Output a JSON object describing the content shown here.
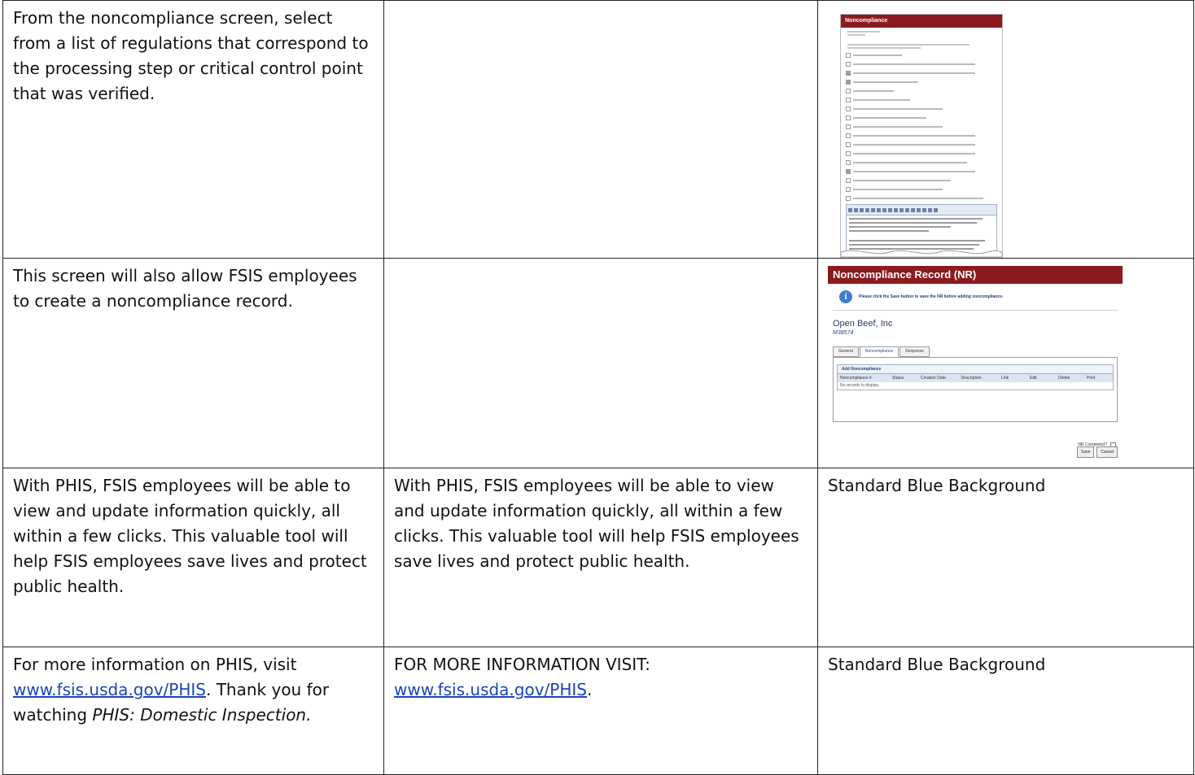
{
  "rows": [
    {
      "col1": "From the noncompliance screen, select from a list of regulations that correspond to the processing step or critical control point that was verified.",
      "col2": "",
      "col3_screenshot": {
        "header": "Noncompliance"
      }
    },
    {
      "col1": "This screen will also allow FSIS employees to create a noncompliance record.",
      "col2": "",
      "col3_screenshot": {
        "header": "Noncompliance Record (NR)",
        "info_message": "Please click the Save button to save the NR before adding noncompliance.",
        "establishment_name": "Open Beef, Inc",
        "establishment_number": "M38574",
        "tabs": [
          "General",
          "Noncompliance",
          "Response"
        ],
        "add_link": "Add Noncompliance",
        "columns": [
          "Noncompliance #",
          "Status",
          "Creation Date",
          "Description",
          "Link",
          "Edit",
          "Delete",
          "Print"
        ],
        "empty_text": "No records to display.",
        "nr_completed_label": "NR Completed?",
        "save_label": "Save",
        "cancel_label": "Cancel"
      }
    },
    {
      "col1": "With PHIS, FSIS employees will be able to view and update information quickly, all within a few clicks.  This valuable tool will help FSIS employees save lives and protect public health.",
      "col2": "With PHIS, FSIS employees will be able to view and update information quickly, all within a few clicks.  This valuable tool will help FSIS employees save lives and protect public health.",
      "col3": "Standard Blue Background"
    },
    {
      "col1_pre": "For more information on PHIS, visit ",
      "col1_link": "www.fsis.usda.gov/PHIS",
      "col1_mid": ".  Thank you for watching ",
      "col1_italic": "PHIS: Domestic Inspection.",
      "col2_pre": "FOR MORE INFORMATION VISIT: ",
      "col2_link": "www.fsis.usda.gov/PHIS",
      "col2_post": ".",
      "col3": "Standard Blue Background"
    }
  ]
}
